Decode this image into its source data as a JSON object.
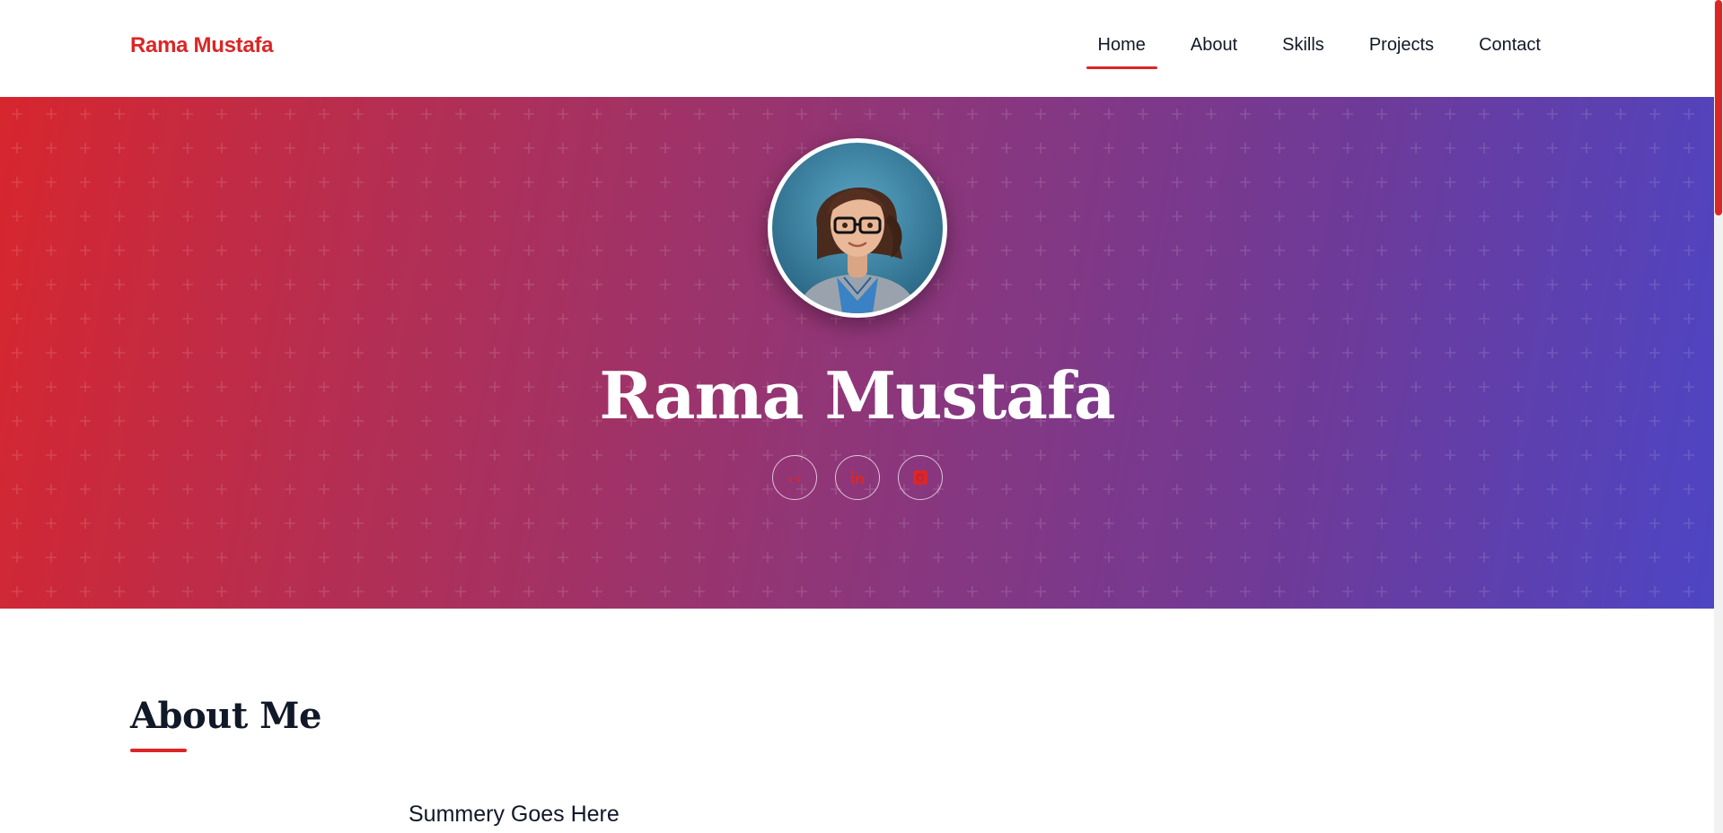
{
  "nav": {
    "brand": "Rama Mustafa",
    "links": [
      "Home",
      "About",
      "Skills",
      "Projects",
      "Contact"
    ],
    "active": "Home"
  },
  "hero": {
    "name": "Rama Mustafa",
    "socials": [
      "github-icon",
      "linkedin-icon",
      "instagram-icon"
    ],
    "gradient": [
      "#d7262e",
      "#8f3678",
      "#4d45c4"
    ]
  },
  "about": {
    "title": "About Me",
    "summary": "Summery Goes Here"
  },
  "colors": {
    "accent": "#dc2626",
    "text": "#111827"
  }
}
